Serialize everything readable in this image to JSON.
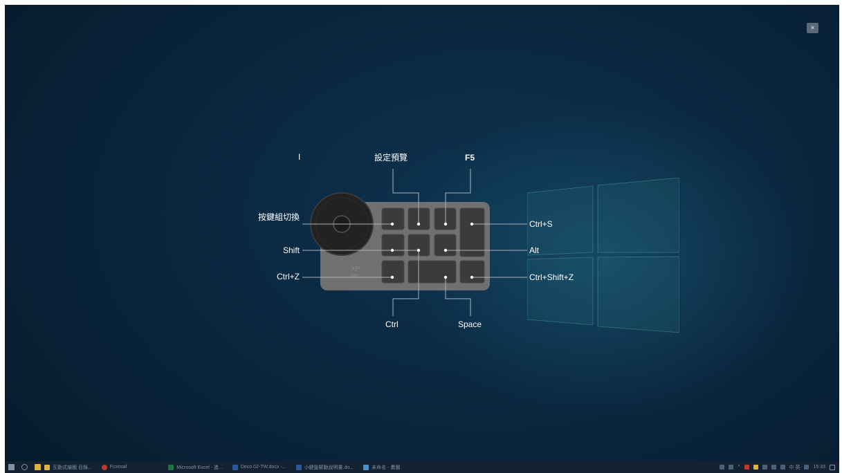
{
  "overlay": {
    "close_label": "×",
    "keys": {
      "top_left": "I",
      "top_middle": "設定預覽",
      "top_right": "F5",
      "left_row1": "按鍵組切換",
      "left_row2": "Shift",
      "left_row3": "Ctrl+Z",
      "right_row1": "Ctrl+S",
      "right_row2": "Alt",
      "right_row3": "Ctrl+Shift+Z",
      "bottom_left": "Ctrl",
      "bottom_right": "Space"
    },
    "device_brand": "XP pen"
  },
  "taskbar": {
    "tasks": [
      {
        "label": "互動式繪圖 目錄...",
        "icon": "folder-icon",
        "color": "#e0b341"
      },
      {
        "label": "Foxmail",
        "icon": "foxmail-icon",
        "color": "#c0392b"
      },
      {
        "label": "Microsoft Excel - 進...",
        "icon": "excel-icon",
        "color": "#217346"
      },
      {
        "label": "Deco 02-TW.docx -...",
        "icon": "word-icon",
        "color": "#2b579a"
      },
      {
        "label": "小鍵盤驅動說明書.do...",
        "icon": "word-icon",
        "color": "#2b579a"
      },
      {
        "label": "未命名 - 畫圖",
        "icon": "paint-icon",
        "color": "#4a90c2"
      }
    ],
    "tray": {
      "ime_label": "中 英",
      "time": "15:33"
    }
  }
}
